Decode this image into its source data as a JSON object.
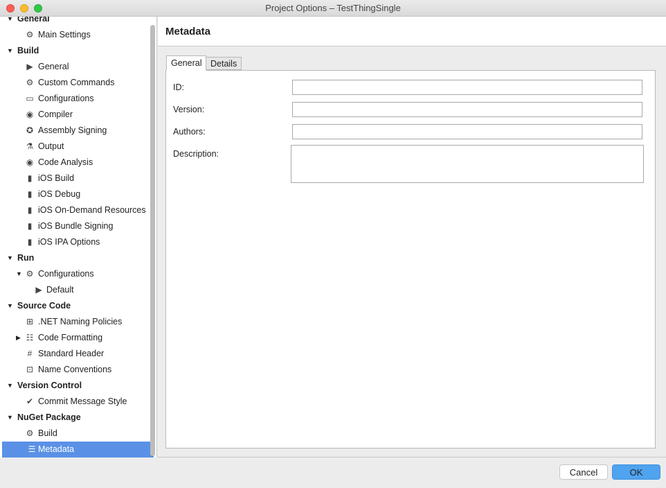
{
  "window": {
    "title": "Project Options – TestThingSingle"
  },
  "sidebar": {
    "rows": [
      {
        "label": "General",
        "level": 0,
        "bold": true,
        "arrow": "down",
        "icon": ""
      },
      {
        "label": "Main Settings",
        "level": 1,
        "icon": "gear-icon",
        "glyph": "⚙"
      },
      {
        "label": "Build",
        "level": 0,
        "bold": true,
        "arrow": "down",
        "icon": ""
      },
      {
        "label": "General",
        "level": 1,
        "icon": "play-bar-icon",
        "glyph": "▶"
      },
      {
        "label": "Custom Commands",
        "level": 1,
        "icon": "gear-icon",
        "glyph": "⚙"
      },
      {
        "label": "Configurations",
        "level": 1,
        "icon": "window-icon",
        "glyph": "▭"
      },
      {
        "label": "Compiler",
        "level": 1,
        "icon": "robot-icon",
        "glyph": "◉"
      },
      {
        "label": "Assembly Signing",
        "level": 1,
        "icon": "badge-check-icon",
        "glyph": "✪"
      },
      {
        "label": "Output",
        "level": 1,
        "icon": "flask-icon",
        "glyph": "⚗"
      },
      {
        "label": "Code Analysis",
        "level": 1,
        "icon": "radio-target-icon",
        "glyph": "◉"
      },
      {
        "label": "iOS Build",
        "level": 1,
        "icon": "phone-icon",
        "glyph": "▮"
      },
      {
        "label": "iOS Debug",
        "level": 1,
        "icon": "phone-icon",
        "glyph": "▮"
      },
      {
        "label": "iOS On-Demand Resources",
        "level": 1,
        "icon": "phone-icon",
        "glyph": "▮"
      },
      {
        "label": "iOS Bundle Signing",
        "level": 1,
        "icon": "phone-icon",
        "glyph": "▮"
      },
      {
        "label": "iOS IPA Options",
        "level": 1,
        "icon": "phone-icon",
        "glyph": "▮"
      },
      {
        "label": "Run",
        "level": 0,
        "bold": true,
        "arrow": "down",
        "icon": ""
      },
      {
        "label": "Configurations",
        "level": 1,
        "arrow": "down",
        "icon": "gear-icon",
        "glyph": "⚙"
      },
      {
        "label": "Default",
        "level": 2,
        "icon": "play-icon",
        "glyph": "▶"
      },
      {
        "label": "Source Code",
        "level": 0,
        "bold": true,
        "arrow": "down",
        "icon": ""
      },
      {
        "label": ".NET Naming Policies",
        "level": 1,
        "icon": "ab-icon",
        "glyph": "⊞"
      },
      {
        "label": "Code Formatting",
        "level": 1,
        "arrow": "right",
        "icon": "format-icon",
        "glyph": "☷"
      },
      {
        "label": "Standard Header",
        "level": 1,
        "icon": "hash-file-icon",
        "glyph": "#"
      },
      {
        "label": "Name Conventions",
        "level": 1,
        "icon": "ir-icon",
        "glyph": "⊡"
      },
      {
        "label": "Version Control",
        "level": 0,
        "bold": true,
        "arrow": "down",
        "icon": ""
      },
      {
        "label": "Commit Message Style",
        "level": 1,
        "icon": "check-circle-icon",
        "glyph": "✔"
      },
      {
        "label": "NuGet Package",
        "level": 0,
        "bold": true,
        "arrow": "down",
        "icon": ""
      },
      {
        "label": "Build",
        "level": 1,
        "icon": "gear-icon",
        "glyph": "⚙"
      },
      {
        "label": "Metadata",
        "level": 1,
        "icon": "document-icon",
        "glyph": "☰",
        "selected": true
      }
    ]
  },
  "main": {
    "title": "Metadata",
    "tabs": [
      "General",
      "Details"
    ],
    "fields": [
      {
        "label": "ID:",
        "value": ""
      },
      {
        "label": "Version:",
        "value": ""
      },
      {
        "label": "Authors:",
        "value": ""
      },
      {
        "label": "Description:",
        "value": ""
      }
    ]
  },
  "footer": {
    "cancel": "Cancel",
    "ok": "OK"
  },
  "colors": {
    "accent": "#5a91e6",
    "ok": "#4fa3ef"
  }
}
